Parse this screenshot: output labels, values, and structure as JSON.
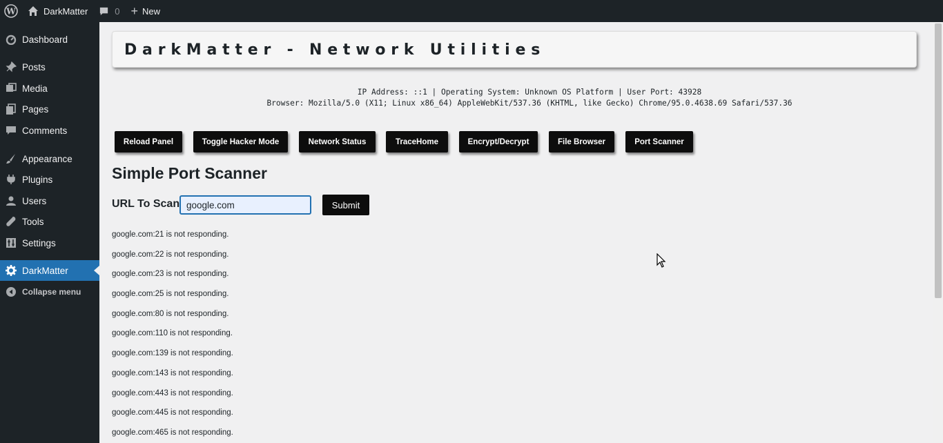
{
  "adminbar": {
    "site_name": "DarkMatter",
    "comments_count": "0",
    "new_label": "New"
  },
  "sidebar": {
    "items": [
      {
        "label": "Dashboard",
        "icon": "dashboard-icon"
      },
      {
        "label": "Posts",
        "icon": "pin-icon"
      },
      {
        "label": "Media",
        "icon": "media-icon"
      },
      {
        "label": "Pages",
        "icon": "pages-icon"
      },
      {
        "label": "Comments",
        "icon": "comment-icon"
      },
      {
        "label": "Appearance",
        "icon": "brush-icon"
      },
      {
        "label": "Plugins",
        "icon": "plug-icon"
      },
      {
        "label": "Users",
        "icon": "user-icon"
      },
      {
        "label": "Tools",
        "icon": "wrench-icon"
      },
      {
        "label": "Settings",
        "icon": "settings-icon"
      },
      {
        "label": "DarkMatter",
        "icon": "gear-icon"
      },
      {
        "label": "Collapse menu",
        "icon": "collapse-icon"
      }
    ],
    "active_index": 10
  },
  "main": {
    "title": "DarkMatter - Network Utilities",
    "info_line1": "IP Address: ::1 | Operating System: Unknown OS Platform | User Port: 43928",
    "info_line2": "Browser: Mozilla/5.0 (X11; Linux x86_64) AppleWebKit/537.36 (KHTML, like Gecko) Chrome/95.0.4638.69 Safari/537.36",
    "buttons": [
      "Reload Panel",
      "Toggle Hacker Mode",
      "Network Status",
      "TraceHome",
      "Encrypt/Decrypt",
      "File Browser",
      "Port Scanner"
    ],
    "scanner": {
      "heading": "Simple Port Scanner",
      "url_label": "URL To Scan:",
      "url_value": "google.com",
      "submit_label": "Submit"
    },
    "results": [
      "google.com:21 is not responding.",
      "google.com:22 is not responding.",
      "google.com:23 is not responding.",
      "google.com:25 is not responding.",
      "google.com:80 is not responding.",
      "google.com:110 is not responding.",
      "google.com:139 is not responding.",
      "google.com:143 is not responding.",
      "google.com:443 is not responding.",
      "google.com:445 is not responding.",
      "google.com:465 is not responding."
    ]
  }
}
